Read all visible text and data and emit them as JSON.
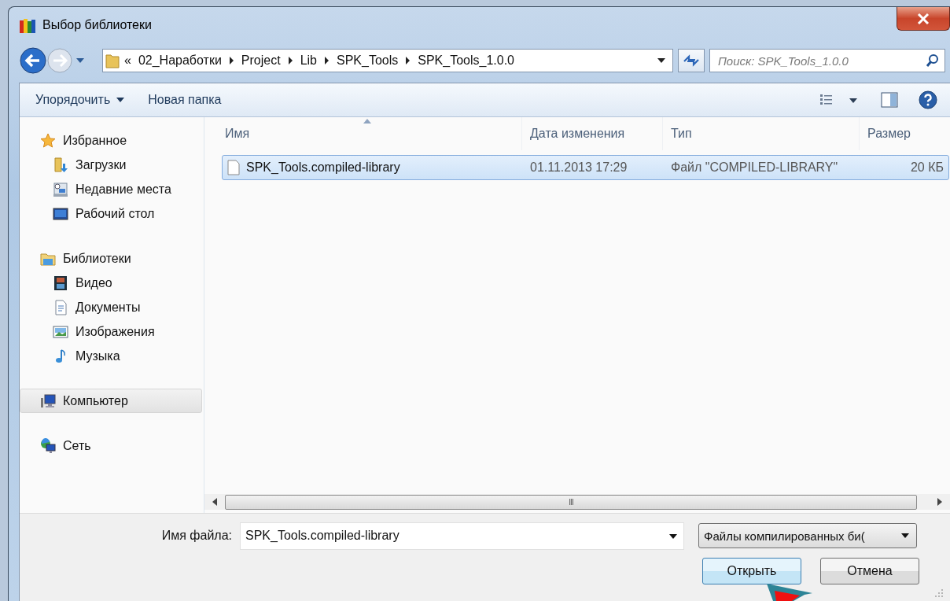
{
  "window": {
    "title": "Выбор библиотеки"
  },
  "address": {
    "overflow": "«",
    "crumbs": [
      "02_Наработки",
      "Project",
      "Lib",
      "SPK_Tools",
      "SPK_Tools_1.0.0"
    ]
  },
  "search": {
    "placeholder": "Поиск: SPK_Tools_1.0.0"
  },
  "toolbar": [
    {
      "label": "Упорядочить",
      "dropdown": true
    },
    {
      "label": "Новая папка",
      "dropdown": false
    }
  ],
  "sidebar": {
    "groups": [
      {
        "label": "Избранное",
        "kind": "star",
        "selected": false,
        "children": [
          {
            "label": "Загрузки",
            "kind": "download",
            "selected": false
          },
          {
            "label": "Недавние места",
            "kind": "recent",
            "selected": false
          },
          {
            "label": "Рабочий стол",
            "kind": "desktop",
            "selected": false
          }
        ]
      },
      {
        "label": "Библиотеки",
        "kind": "library",
        "selected": false,
        "children": [
          {
            "label": "Видео",
            "kind": "video",
            "selected": false
          },
          {
            "label": "Документы",
            "kind": "document",
            "selected": false
          },
          {
            "label": "Изображения",
            "kind": "image",
            "selected": false
          },
          {
            "label": "Музыка",
            "kind": "music",
            "selected": false
          }
        ]
      },
      {
        "label": "Компьютер",
        "kind": "computer",
        "selected": true
      },
      {
        "label": "Сеть",
        "kind": "network",
        "selected": false
      }
    ]
  },
  "table": {
    "columns": [
      {
        "label": "Имя",
        "sorted": true
      },
      {
        "label": "Дата изменения",
        "sorted": false
      },
      {
        "label": "Тип",
        "sorted": false
      },
      {
        "label": "Размер",
        "sorted": false
      }
    ],
    "rows": [
      {
        "name": "SPK_Tools.compiled-library",
        "date": "01.11.2013 17:29",
        "type": "Файл \"COMPILED-LIBRARY\"",
        "size": "20 КБ",
        "selected": true
      }
    ]
  },
  "scrollbar": {
    "grip": "III"
  },
  "file_name": {
    "label": "Имя файла:",
    "value": "SPK_Tools.compiled-library"
  },
  "file_type": {
    "value": "Файлы компилированных би("
  },
  "buttons": [
    {
      "label": "Открыть",
      "default": true
    },
    {
      "label": "Отмена",
      "default": false
    }
  ]
}
